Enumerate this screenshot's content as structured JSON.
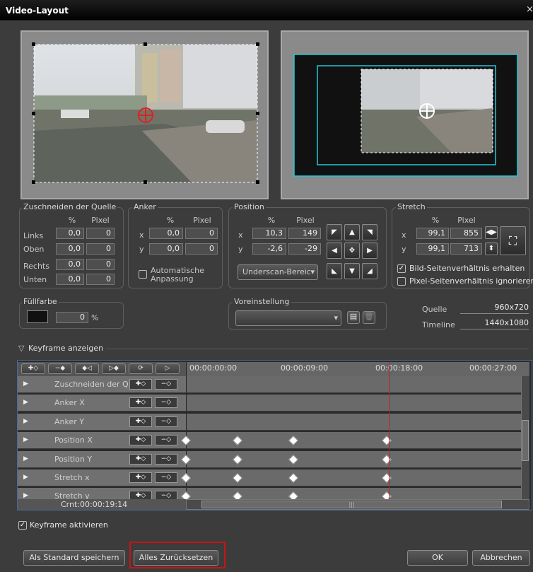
{
  "window": {
    "title": "Video-Layout",
    "close": "×"
  },
  "crop": {
    "label": "Zuschneiden der Quelle",
    "pct": "%",
    "px": "Pixel",
    "rows": [
      {
        "label": "Links",
        "pct": "0,0",
        "px": "0"
      },
      {
        "label": "Oben",
        "pct": "0,0",
        "px": "0"
      },
      {
        "label": "Rechts",
        "pct": "0,0",
        "px": "0"
      },
      {
        "label": "Unten",
        "pct": "0,0",
        "px": "0"
      }
    ]
  },
  "anchor": {
    "label": "Anker",
    "pct": "%",
    "px": "Pixel",
    "x_label": "x",
    "x_pct": "0,0",
    "x_px": "0",
    "y_label": "y",
    "y_pct": "0,0",
    "y_px": "0",
    "auto_fit": "Automatische Anpassung"
  },
  "position": {
    "label": "Position",
    "pct": "%",
    "px": "Pixel",
    "x_label": "x",
    "x_pct": "10,3",
    "x_px": "149",
    "y_label": "y",
    "y_pct": "-2,6",
    "y_px": "-29",
    "underscan": "Underscan-Bereic"
  },
  "stretch": {
    "label": "Stretch",
    "pct": "%",
    "px": "Pixel",
    "x_label": "x",
    "x_pct": "99,1",
    "x_px": "855",
    "y_label": "y",
    "y_pct": "99,1",
    "y_px": "713",
    "keep_aspect": "Bild-Seitenverhältnis erhalten",
    "ignore_pixel_aspect": "Pixel-Seitenverhältnis ignorieren",
    "keep_aspect_checked": true,
    "ignore_pixel_aspect_checked": false
  },
  "fill": {
    "label": "Füllfarbe",
    "value": "0",
    "unit": "%",
    "color": "#111111"
  },
  "preset": {
    "label": "Voreinstellung",
    "value": ""
  },
  "resolution": {
    "source_label": "Quelle",
    "source_value": "960x720",
    "timeline_label": "Timeline",
    "timeline_value": "1440x1080"
  },
  "keyframes": {
    "toggle_label": "Keyframe anzeigen",
    "ruler": [
      "00:00:00:00",
      "00:00:09:00",
      "00:00:18:00",
      "00:00:27:00"
    ],
    "rows": [
      {
        "name": "Zuschneiden der Q...",
        "kf": []
      },
      {
        "name": "Anker X",
        "kf": []
      },
      {
        "name": "Anker Y",
        "kf": []
      },
      {
        "name": "Position X",
        "kf": [
          0,
          0.155,
          0.32,
          0.6
        ]
      },
      {
        "name": "Position Y",
        "kf": [
          0,
          0.155,
          0.32,
          0.6
        ]
      },
      {
        "name": "Stretch x",
        "kf": [
          0,
          0.155,
          0.32,
          0.6
        ]
      },
      {
        "name": "Stretch y",
        "kf": [
          0,
          0.155,
          0.32,
          0.6
        ]
      }
    ],
    "current_time": "Crnt:00:00:19:14",
    "playhead": 0.605,
    "activate_label": "Keyframe aktivieren",
    "activate_checked": true
  },
  "buttons": {
    "save_default": "Als Standard speichern",
    "reset_all": "Alles Zurücksetzen",
    "ok": "OK",
    "cancel": "Abbrechen"
  },
  "colors": {
    "highlight": "#c81414",
    "frame": "#22c8d8",
    "playhead": "#c02020"
  }
}
